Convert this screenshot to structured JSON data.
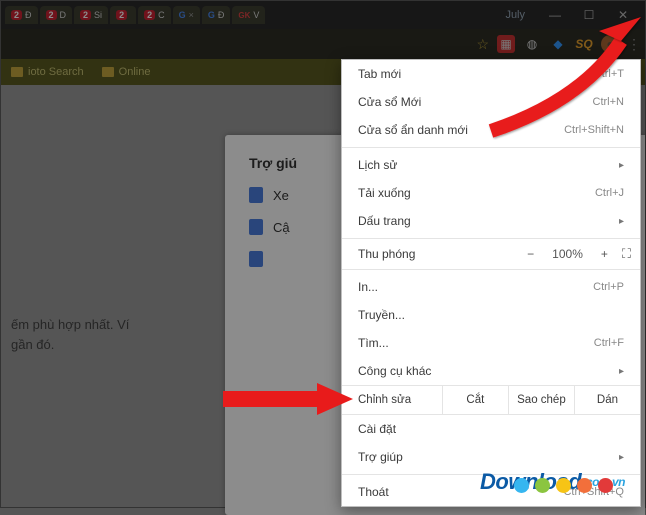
{
  "window": {
    "title_center": "July",
    "tabs": [
      {
        "badge": "2",
        "glyph": "Đ"
      },
      {
        "badge": "2",
        "glyph": "D"
      },
      {
        "badge": "2",
        "glyph": "Si"
      },
      {
        "badge": "2",
        "glyph": ""
      },
      {
        "badge": "2",
        "glyph": "C"
      },
      {
        "icon": "G",
        "close": "×"
      },
      {
        "icon": "G",
        "glyph": "Đ"
      },
      {
        "icon": "GK",
        "glyph": "V"
      }
    ],
    "controls": {
      "min": "—",
      "max": "☐",
      "close": "✕"
    }
  },
  "toolbar": {
    "star": "☆",
    "ext_red": "▦",
    "ext_globe": "◍",
    "ext_diamond": "◆",
    "ext_sq": "SQ",
    "ext_ball": "●",
    "menu_icon": "⋮"
  },
  "bookmarks": {
    "items": [
      "ioto Search",
      "Online"
    ]
  },
  "page": {
    "card_title": "Trợ giú",
    "rows": [
      "Xe",
      "Cậ",
      ""
    ],
    "left_text_1": "ếm phù hợp nhất. Ví",
    "left_text_2": "gần đó."
  },
  "menu": {
    "items": [
      {
        "label": "Tab mới",
        "shortcut": "Ctrl+T"
      },
      {
        "label": "Cửa sổ Mới",
        "shortcut": "Ctrl+N"
      },
      {
        "label": "Cửa sổ ẩn danh mới",
        "shortcut": "Ctrl+Shift+N"
      }
    ],
    "items2": [
      {
        "label": "Lịch sử",
        "arrow": "▸"
      },
      {
        "label": "Tải xuống",
        "shortcut": "Ctrl+J"
      },
      {
        "label": "Dấu trang",
        "arrow": "▸"
      }
    ],
    "zoom": {
      "label": "Thu phóng",
      "minus": "−",
      "value": "100%",
      "plus": "+",
      "full": "⛶"
    },
    "items3": [
      {
        "label": "In...",
        "shortcut": "Ctrl+P"
      },
      {
        "label": "Truyền..."
      },
      {
        "label": "Tìm...",
        "shortcut": "Ctrl+F"
      },
      {
        "label": "Công cụ khác",
        "arrow": "▸"
      }
    ],
    "edit": {
      "label": "Chỉnh sửa",
      "cut": "Cắt",
      "copy": "Sao chép",
      "paste": "Dán"
    },
    "settings": {
      "label": "Cài đặt"
    },
    "help": {
      "label": "Trợ giúp",
      "arrow": "▸"
    },
    "exit": {
      "label": "Thoát",
      "shortcut": "Ctrl+Shift+Q"
    }
  },
  "watermark": {
    "main": "Download",
    "suffix": ".com.vn"
  },
  "dot_colors": [
    "#36b6f0",
    "#8bc540",
    "#f6c416",
    "#f26f3b",
    "#e23a3a"
  ]
}
